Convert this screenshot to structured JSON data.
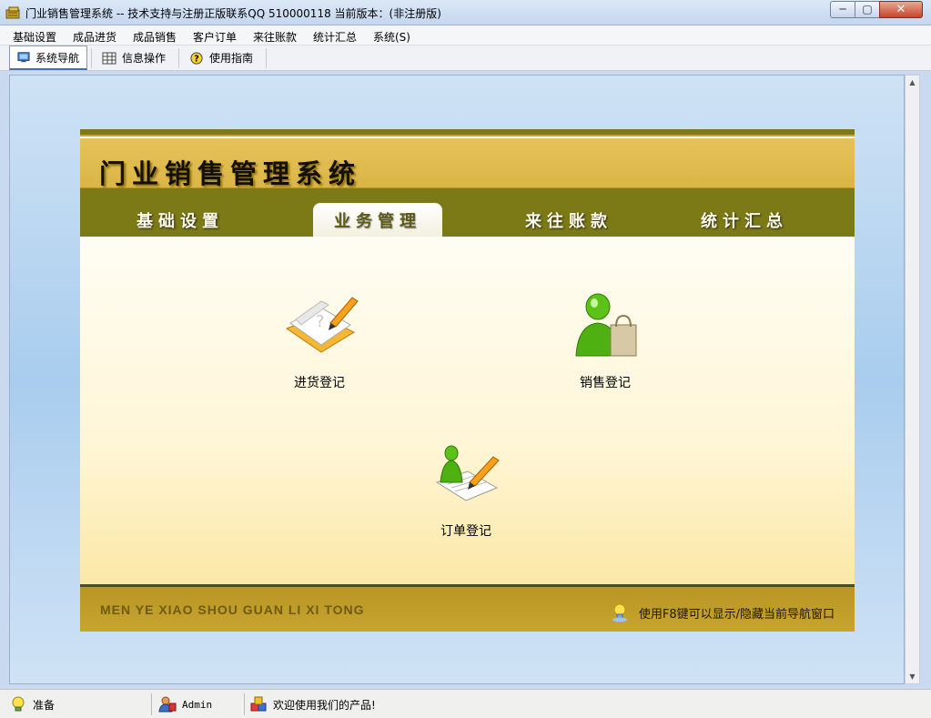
{
  "window": {
    "title": "门业销售管理系统 -- 技术支持与注册正版联系QQ 510000118    当前版本：(非注册版)",
    "minimize_glyph": "─",
    "maximize_glyph": "▢",
    "close_glyph": "✕"
  },
  "menu": {
    "items": [
      "基础设置",
      "成品进货",
      "成品销售",
      "客户订单",
      "来往账款",
      "统计汇总",
      "系统(S)"
    ]
  },
  "toolbar": {
    "items": [
      {
        "label": "系统导航",
        "icon": "monitor-icon",
        "active": true
      },
      {
        "label": "信息操作",
        "icon": "grid-icon",
        "active": false
      },
      {
        "label": "使用指南",
        "icon": "help-icon",
        "active": false
      }
    ]
  },
  "panel": {
    "title": "门业销售管理系统",
    "tabs": [
      {
        "label": "基础设置",
        "active": false
      },
      {
        "label": "业务管理",
        "active": true
      },
      {
        "label": "来往账款",
        "active": false
      },
      {
        "label": "统计汇总",
        "active": false
      }
    ],
    "items": [
      {
        "label": "进货登记",
        "icon": "notebook-pencil-icon"
      },
      {
        "label": "销售登记",
        "icon": "user-shopping-bag-icon"
      },
      {
        "label": "订单登记",
        "icon": "user-document-pencil-icon"
      }
    ],
    "footer_left": "MEN YE XIAO SHOU GUAN LI XI TONG",
    "footer_right": "使用F8键可以显示/隐藏当前导航窗口"
  },
  "statusbar": {
    "status": "准备",
    "user": "Admin",
    "message": "欢迎使用我们的产品!"
  },
  "colors": {
    "tabbar": "#7c7a16",
    "header": "#e5c25a",
    "footer": "#c8a52e"
  }
}
